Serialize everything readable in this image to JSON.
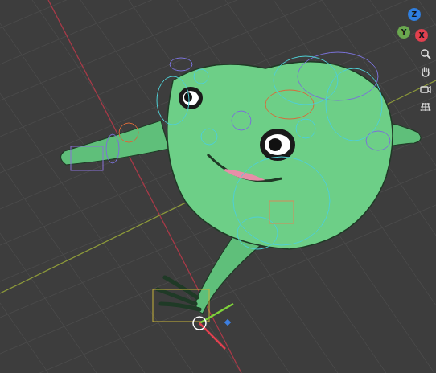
{
  "viewport": {
    "axes": [
      {
        "label": "Z",
        "color": "#2f7fe0"
      },
      {
        "label": "Y",
        "color": "#6aa84f"
      },
      {
        "label": "X",
        "color": "#e0404f"
      }
    ]
  }
}
